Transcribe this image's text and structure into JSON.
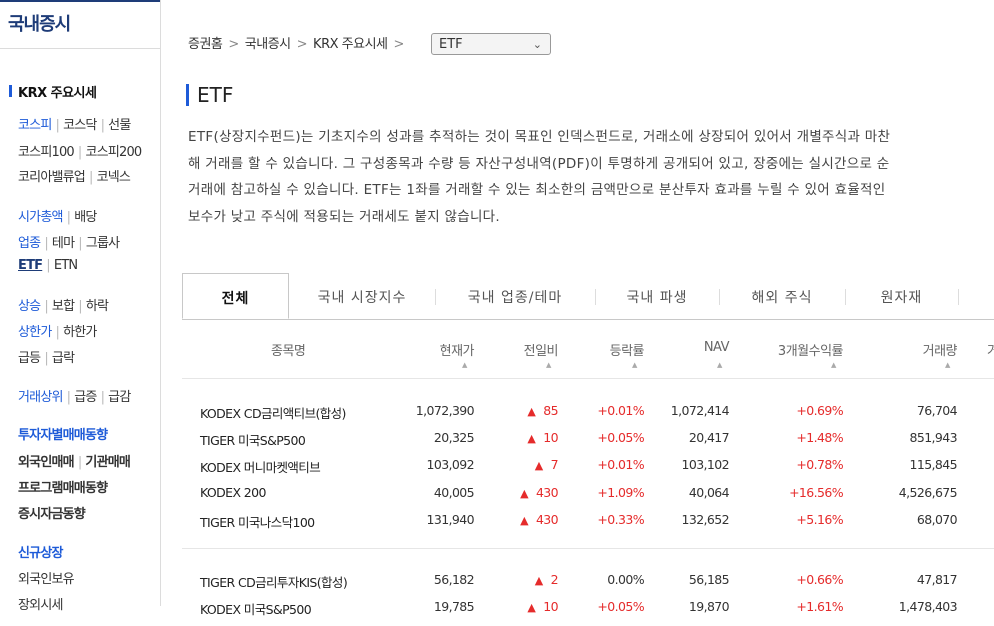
{
  "sidebar": {
    "title": "국내증시",
    "section": "KRX 주요시세",
    "rows": [
      [
        "코스피",
        "코스닥",
        "선물"
      ],
      [
        "코스피100",
        "코스피200"
      ],
      [
        "코리아밸류업",
        "코넥스"
      ],
      [
        "시가총액",
        "배당"
      ],
      [
        "업종",
        "테마",
        "그룹사"
      ],
      [
        "ETF",
        "ETN"
      ],
      [
        "상승",
        "보합",
        "하락"
      ],
      [
        "상한가",
        "하한가"
      ],
      [
        "급등",
        "급락"
      ],
      [
        "거래상위",
        "급증",
        "급감"
      ],
      [
        "투자자별매매동향"
      ],
      [
        "외국인매매",
        "기관매매"
      ],
      [
        "프로그램매매동향"
      ],
      [
        "증시자금동향"
      ],
      [
        "신규상장"
      ],
      [
        "외국인보유"
      ],
      [
        "장외시세"
      ]
    ]
  },
  "breadcrumb": {
    "items": [
      "증권홈",
      "국내증시",
      "KRX 주요시세"
    ],
    "select_value": "ETF"
  },
  "page_title": "ETF",
  "description": [
    "ETF(상장지수펀드)는 기초지수의 성과를 추적하는 것이 목표인 인덱스펀드로, 거래소에 상장되어 있어서 개별주식과 마찬",
    "해 거래를 할 수 있습니다. 그 구성종목과 수량 등 자산구성내역(PDF)이 투명하게 공개되어 있고, 장중에는 실시간으로 순",
    "거래에 참고하실 수 있습니다. ETF는 1좌를 거래할 수 있는 최소한의 금액만으로 분산투자 효과를 누릴 수 있어 효율적인",
    "보수가 낮고 주식에 적용되는 거래세도 붙지 않습니다."
  ],
  "tabs": [
    "전체",
    "국내 시장지수",
    "국내 업종/테마",
    "국내 파생",
    "해외 주식",
    "원자재"
  ],
  "table": {
    "headers": [
      "종목명",
      "현재가",
      "전일비",
      "등락률",
      "NAV",
      "3개월수익률",
      "거래량",
      "거"
    ],
    "rows": [
      {
        "name": "KODEX CD금리액티브(합성)",
        "price": "1,072,390",
        "change": "85",
        "rate": "+0.01%",
        "nav": "1,072,414",
        "ret3m": "+0.69%",
        "volume": "76,704"
      },
      {
        "name": "TIGER 미국S&P500",
        "price": "20,325",
        "change": "10",
        "rate": "+0.05%",
        "nav": "20,417",
        "ret3m": "+1.48%",
        "volume": "851,943"
      },
      {
        "name": "KODEX 머니마켓액티브",
        "price": "103,092",
        "change": "7",
        "rate": "+0.01%",
        "nav": "103,102",
        "ret3m": "+0.78%",
        "volume": "115,845"
      },
      {
        "name": "KODEX 200",
        "price": "40,005",
        "change": "430",
        "rate": "+1.09%",
        "nav": "40,064",
        "ret3m": "+16.56%",
        "volume": "4,526,675"
      },
      {
        "name": "TIGER 미국나스닥100",
        "price": "131,940",
        "change": "430",
        "rate": "+0.33%",
        "nav": "132,652",
        "ret3m": "+5.16%",
        "volume": "68,070"
      },
      {
        "name": "TIGER CD금리투자KIS(합성)",
        "price": "56,182",
        "change": "2",
        "rate": "0.00%",
        "nav": "56,185",
        "ret3m": "+0.66%",
        "volume": "47,817"
      },
      {
        "name": "KODEX 미국S&P500",
        "price": "19,785",
        "change": "10",
        "rate": "+0.05%",
        "nav": "19,870",
        "ret3m": "+1.61%",
        "volume": "1,478,403"
      }
    ]
  },
  "colors": {
    "brand": "#1e3c78",
    "accent": "#1e5bd8",
    "up": "#e52b2b"
  },
  "icons": {
    "select": "chevron-down-icon",
    "sort": "sort-arrow-icon",
    "rise": "up-triangle-icon"
  }
}
